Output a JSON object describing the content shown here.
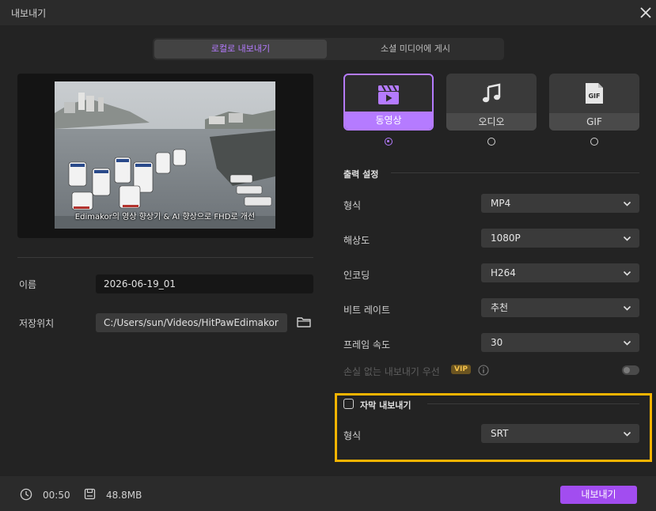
{
  "window": {
    "title": "내보내기"
  },
  "tabs": [
    {
      "label": "로컬로 내보내기",
      "active": true
    },
    {
      "label": "소셜 미디어에 게시",
      "active": false
    }
  ],
  "preview": {
    "subtitle": "Edimakor의 영상 향상기 & AI 향상으로 FHD로 개선"
  },
  "file": {
    "name_label": "이름",
    "name_value": "2026-06-19_01",
    "location_label": "저장위치",
    "location_value": "C:/Users/sun/Videos/HitPawEdimakor"
  },
  "formats": [
    {
      "label": "동영상",
      "icon": "clapperboard-icon",
      "selected": true
    },
    {
      "label": "오디오",
      "icon": "music-note-icon",
      "selected": false
    },
    {
      "label": "GIF",
      "icon": "gif-file-icon",
      "icon_text": "GIF",
      "selected": false
    }
  ],
  "output": {
    "section_title": "출력 설정",
    "rows": [
      {
        "label": "형식",
        "value": "MP4"
      },
      {
        "label": "해상도",
        "value": "1080P"
      },
      {
        "label": "인코딩",
        "value": "H264"
      },
      {
        "label": "비트 레이트",
        "value": "추천"
      },
      {
        "label": "프레임 속도",
        "value": "30"
      }
    ],
    "lossless_label": "손실 없는 내보내기 우선",
    "vip_badge": "VIP",
    "lossless_enabled": false
  },
  "subtitles": {
    "title": "자막 내보내기",
    "checked": false,
    "format_label": "형식",
    "format_value": "SRT"
  },
  "footer": {
    "duration": "00:50",
    "size": "48.8MB",
    "export_label": "내보내기"
  },
  "colors": {
    "accent": "#b57bff",
    "export_button": "#a24df0",
    "highlight_border": "#f5b400",
    "vip": "#f3c14b"
  }
}
